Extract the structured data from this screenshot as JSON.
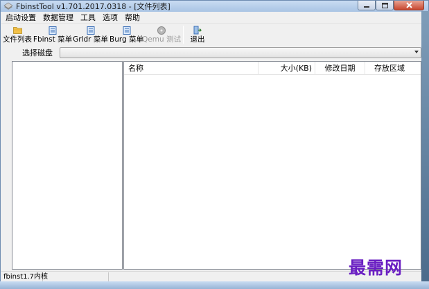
{
  "window": {
    "title": "FbinstTool v1.701.2017.0318 - [文件列表]"
  },
  "menu": [
    "启动设置",
    "数据管理",
    "工具",
    "选项",
    "帮助"
  ],
  "toolbar": {
    "file_list": "文件列表",
    "fbinst_menu": "Fbinst 菜单",
    "grldr_menu": "Grldr 菜单",
    "burg_menu": "Burg 菜单",
    "qemu_test": "Qemu 测试",
    "exit": "退出"
  },
  "disk": {
    "label": "选择磁盘",
    "selected": ""
  },
  "file_list": {
    "columns": [
      "名称",
      "大小(KB)",
      "修改日期",
      "存放区域"
    ],
    "rows": []
  },
  "status": {
    "cell1": "fbinst1.7内核",
    "cell2": ""
  },
  "watermark": "最需网",
  "colors": {
    "watermark": "#6a1fc2",
    "titlebar": "#b7cfea",
    "close_button": "#c8462f"
  }
}
